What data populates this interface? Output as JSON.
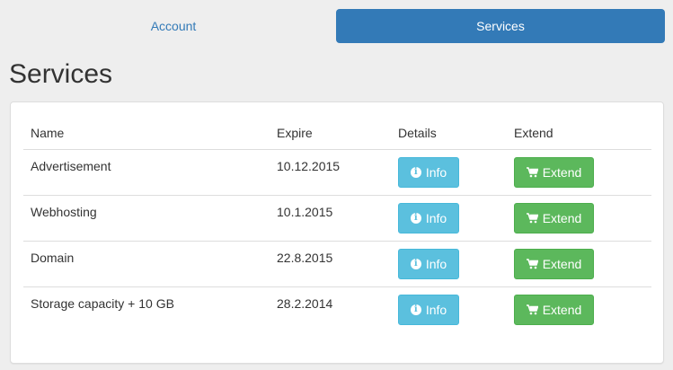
{
  "tabs": {
    "account_label": "Account",
    "services_label": "Services"
  },
  "page": {
    "title": "Services"
  },
  "table": {
    "headers": {
      "name": "Name",
      "expire": "Expire",
      "details": "Details",
      "extend": "Extend"
    },
    "rows": [
      {
        "name": "Advertisement",
        "expire": "10.12.2015",
        "info_label": "Info",
        "extend_label": "Extend"
      },
      {
        "name": "Webhosting",
        "expire": "10.1.2015",
        "info_label": "Info",
        "extend_label": "Extend"
      },
      {
        "name": "Domain",
        "expire": "22.8.2015",
        "info_label": "Info",
        "extend_label": "Extend"
      },
      {
        "name": "Storage capacity + 10 GB",
        "expire": "28.2.2014",
        "info_label": "Info",
        "extend_label": "Extend"
      }
    ]
  },
  "icons": {
    "info": "info-sign-icon",
    "extend": "shopping-cart-icon"
  },
  "colors": {
    "primary": "#337ab7",
    "info": "#5bc0de",
    "success": "#5cb85c"
  }
}
